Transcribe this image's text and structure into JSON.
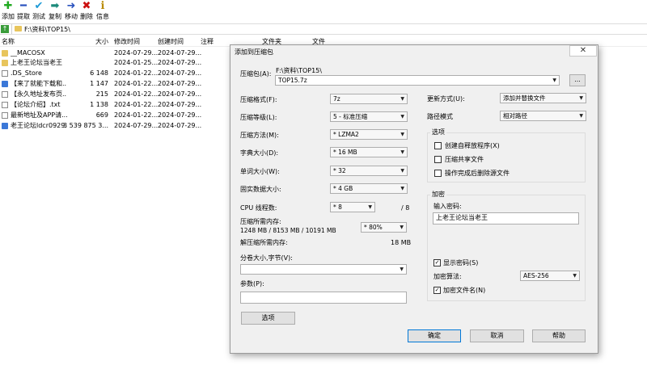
{
  "toolbar": {
    "buttons": [
      {
        "label": "添加",
        "icon": "plus-icon",
        "color": "#22aa22"
      },
      {
        "label": "提取",
        "icon": "minus-icon",
        "color": "#2a52be"
      },
      {
        "label": "测试",
        "icon": "check-icon",
        "color": "#1f9bd7"
      },
      {
        "label": "复制",
        "icon": "copy-arrow-icon",
        "color": "#1b8a7a"
      },
      {
        "label": "移动",
        "icon": "move-arrow-icon",
        "color": "#2a52be"
      },
      {
        "label": "删除",
        "icon": "delete-x-icon",
        "color": "#cc1111"
      },
      {
        "label": "信息",
        "icon": "info-icon",
        "color": "#b88a00"
      }
    ]
  },
  "address": {
    "path": "F:\\资料\\TOP15\\"
  },
  "filelist": {
    "columns": {
      "name": "名称",
      "size": "大小",
      "modified": "修改时间",
      "created": "创建时间",
      "comment": "注释",
      "folders": "文件夹",
      "files": "文件"
    },
    "rows": [
      {
        "name": "__MACOSX",
        "size": "",
        "modified": "2024-07-29...",
        "created": "2024-07-29...",
        "icon": "folder-icon"
      },
      {
        "name": "上老王论坛当老王",
        "size": "",
        "modified": "2024-01-25...",
        "created": "2024-07-29...",
        "icon": "folder-icon"
      },
      {
        "name": ".DS_Store",
        "size": "6 148",
        "modified": "2024-01-22...",
        "created": "2024-07-29...",
        "icon": "file-icon"
      },
      {
        "name": "【来了就能下载和...",
        "size": "1 147",
        "modified": "2024-01-22...",
        "created": "2024-07-29...",
        "icon": "web-icon"
      },
      {
        "name": "【永久地址发布页...",
        "size": "215",
        "modified": "2024-01-22...",
        "created": "2024-07-29...",
        "icon": "file-icon"
      },
      {
        "name": "【论坛介绍】.txt",
        "size": "1 138",
        "modified": "2024-01-22...",
        "created": "2024-07-29...",
        "icon": "file-icon"
      },
      {
        "name": "最新地址及APP请...",
        "size": "669",
        "modified": "2024-01-22...",
        "created": "2024-07-29...",
        "icon": "file-icon"
      },
      {
        "name": "老王论坛ldcr0929...",
        "size": "3 539 875 3...",
        "modified": "2024-07-29...",
        "created": "2024-07-29...",
        "icon": "web-icon"
      }
    ]
  },
  "dialog": {
    "title": "添加到压缩包",
    "archive_label": "压缩包(A):",
    "archive_dir": "F:\\资料\\TOP15\\",
    "archive_name": "TOP15.7z",
    "browse_label": "...",
    "format_label": "压缩格式(F):",
    "format_value": "7z",
    "level_label": "压缩等级(L):",
    "level_value": "5 - 标准压缩",
    "method_label": "压缩方法(M):",
    "method_value": "* LZMA2",
    "dict_label": "字典大小(D):",
    "dict_value": "* 16 MB",
    "word_label": "单词大小(W):",
    "word_value": "* 32",
    "solid_label": "固实数据大小:",
    "solid_value": "* 4 GB",
    "threads_label": "CPU 线程数:",
    "threads_value": "* 8",
    "threads_max": "/ 8",
    "mem_label": "压缩所需内存:",
    "mem_detail": "1248 MB / 8153 MB / 10191 MB",
    "mem_percent": "* 80%",
    "decomp_label": "解压缩所需内存:",
    "decomp_value": "18 MB",
    "split_label": "分卷大小,字节(V):",
    "split_value": "",
    "params_label": "参数(P):",
    "params_value": "",
    "options_button": "选项",
    "update_label": "更新方式(U):",
    "update_value": "添加并替换文件",
    "path_label": "路径模式",
    "path_value": "相对路径",
    "options_group": "选项",
    "sfx_label": "创建自释放程序(X)",
    "sfx_checked": false,
    "shared_label": "压缩共享文件",
    "shared_checked": false,
    "delete_label": "操作完成后删除源文件",
    "delete_checked": false,
    "encrypt_group": "加密",
    "password_label": "输入密码:",
    "password_value": "上老王论坛当老王",
    "show_password_label": "显示密码(S)",
    "show_password_checked": true,
    "enc_method_label": "加密算法:",
    "enc_method_value": "AES-256",
    "encrypt_names_label": "加密文件名(N)",
    "encrypt_names_checked": true,
    "ok_button": "确定",
    "cancel_button": "取消",
    "help_button": "帮助"
  }
}
